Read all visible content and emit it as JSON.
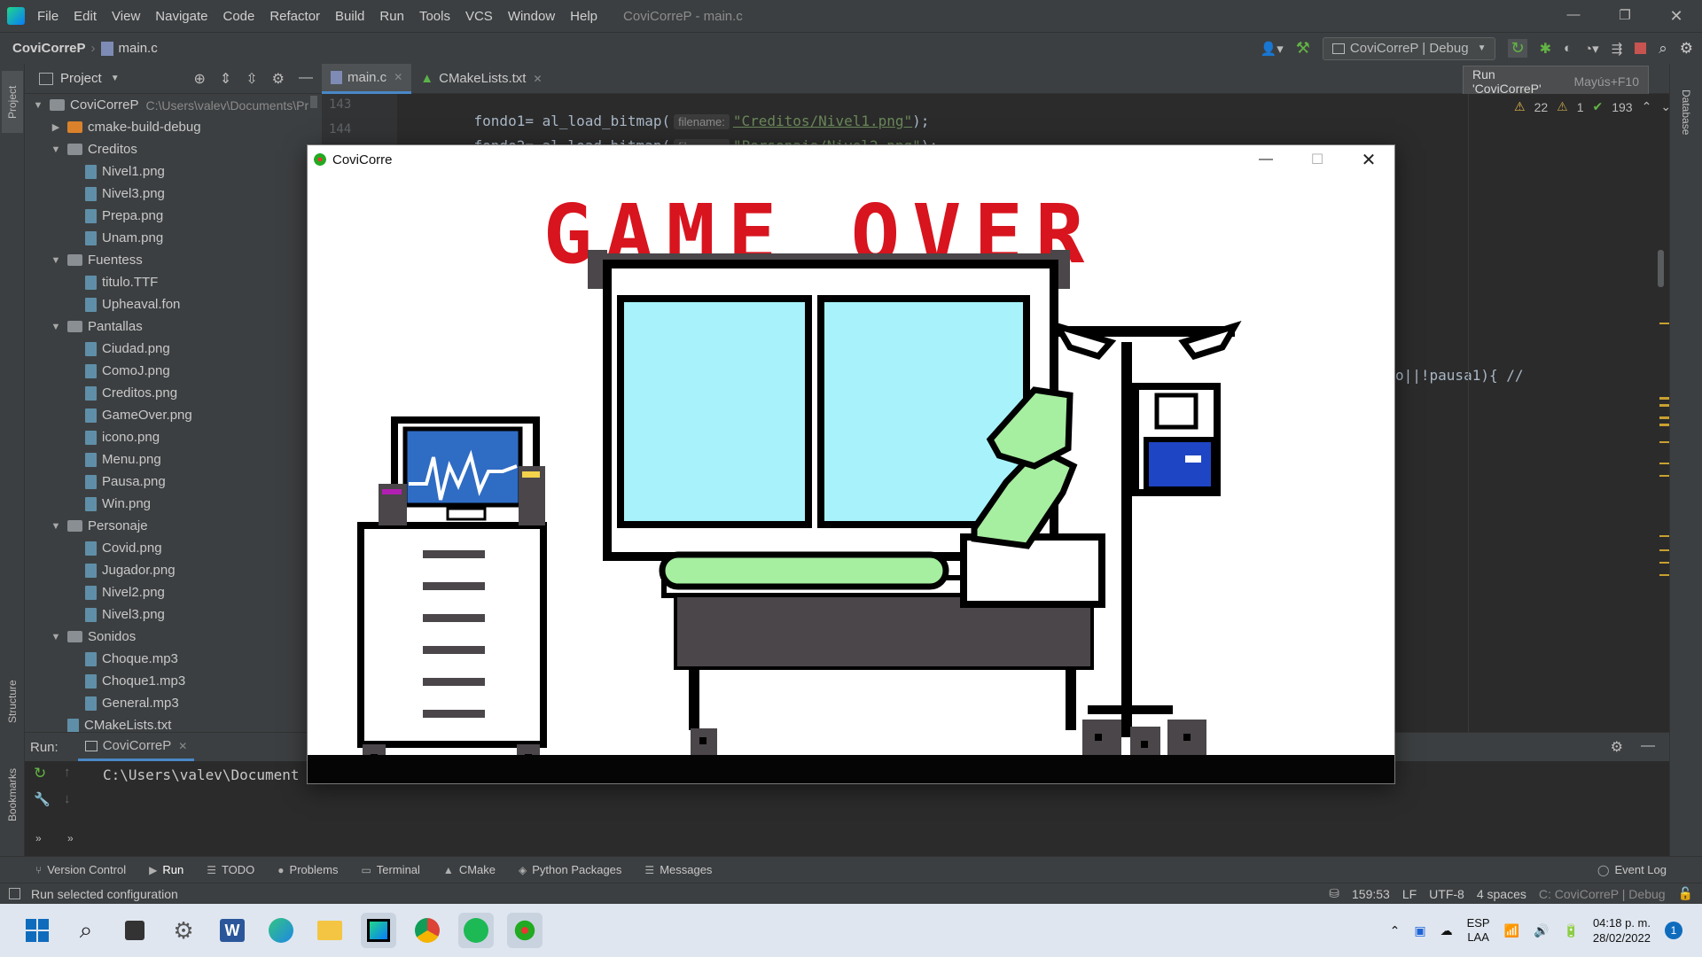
{
  "menubar": {
    "items": [
      "File",
      "Edit",
      "View",
      "Navigate",
      "Code",
      "Refactor",
      "Build",
      "Run",
      "Tools",
      "VCS",
      "Window",
      "Help"
    ],
    "title": "CoviCorreP - main.c"
  },
  "navbar": {
    "project": "CoviCorreP",
    "file": "main.c",
    "run_config": "CoviCorreP | Debug"
  },
  "tooltip": {
    "text": "Run 'CoviCorreP'",
    "shortcut": "Mayús+F10"
  },
  "project_panel": {
    "title": "Project",
    "root_name": "CoviCorreP",
    "root_path": "C:\\Users\\valev\\Documents\\Pr",
    "tree": [
      {
        "label": "cmake-build-debug",
        "kind": "folder-orange",
        "depth": 1,
        "arrow": "▶"
      },
      {
        "label": "Creditos",
        "kind": "folder",
        "depth": 1,
        "arrow": "▼"
      },
      {
        "label": "Nivel1.png",
        "kind": "file",
        "depth": 2,
        "arrow": ""
      },
      {
        "label": "Nivel3.png",
        "kind": "file",
        "depth": 2,
        "arrow": ""
      },
      {
        "label": "Prepa.png",
        "kind": "file",
        "depth": 2,
        "arrow": ""
      },
      {
        "label": "Unam.png",
        "kind": "file",
        "depth": 2,
        "arrow": ""
      },
      {
        "label": "Fuentess",
        "kind": "folder",
        "depth": 1,
        "arrow": "▼"
      },
      {
        "label": "titulo.TTF",
        "kind": "file",
        "depth": 2,
        "arrow": ""
      },
      {
        "label": "Upheaval.fon",
        "kind": "file",
        "depth": 2,
        "arrow": ""
      },
      {
        "label": "Pantallas",
        "kind": "folder",
        "depth": 1,
        "arrow": "▼"
      },
      {
        "label": "Ciudad.png",
        "kind": "file",
        "depth": 2,
        "arrow": ""
      },
      {
        "label": "ComoJ.png",
        "kind": "file",
        "depth": 2,
        "arrow": ""
      },
      {
        "label": "Creditos.png",
        "kind": "file",
        "depth": 2,
        "arrow": ""
      },
      {
        "label": "GameOver.png",
        "kind": "file",
        "depth": 2,
        "arrow": ""
      },
      {
        "label": "icono.png",
        "kind": "file",
        "depth": 2,
        "arrow": ""
      },
      {
        "label": "Menu.png",
        "kind": "file",
        "depth": 2,
        "arrow": ""
      },
      {
        "label": "Pausa.png",
        "kind": "file",
        "depth": 2,
        "arrow": ""
      },
      {
        "label": "Win.png",
        "kind": "file",
        "depth": 2,
        "arrow": ""
      },
      {
        "label": "Personaje",
        "kind": "folder",
        "depth": 1,
        "arrow": "▼"
      },
      {
        "label": "Covid.png",
        "kind": "file",
        "depth": 2,
        "arrow": ""
      },
      {
        "label": "Jugador.png",
        "kind": "file",
        "depth": 2,
        "arrow": ""
      },
      {
        "label": "Nivel2.png",
        "kind": "file",
        "depth": 2,
        "arrow": ""
      },
      {
        "label": "Nivel3.png",
        "kind": "file",
        "depth": 2,
        "arrow": ""
      },
      {
        "label": "Sonidos",
        "kind": "folder",
        "depth": 1,
        "arrow": "▼"
      },
      {
        "label": "Choque.mp3",
        "kind": "file",
        "depth": 2,
        "arrow": ""
      },
      {
        "label": "Choque1.mp3",
        "kind": "file",
        "depth": 2,
        "arrow": ""
      },
      {
        "label": "General.mp3",
        "kind": "file",
        "depth": 2,
        "arrow": ""
      },
      {
        "label": "CMakeLists.txt",
        "kind": "file",
        "depth": 1,
        "arrow": ""
      }
    ]
  },
  "editor": {
    "tabs": [
      "main.c",
      "CMakeLists.txt"
    ],
    "lines": [
      {
        "num": "143",
        "pre": "fondo1= al_load_bitmap(",
        "hint": "filename:",
        "str": "\"Creditos/Nivel1.png\"",
        "post": ");"
      },
      {
        "num": "144",
        "pre": "fondo2= al_load_bitmap(",
        "hint": "filename:",
        "str": "\"Personaje/Nivel2.png\"",
        "post": ");"
      }
    ],
    "partial_code": "o||!pausa1){ //",
    "inspections": {
      "warnings": "22",
      "weak_warnings": "1",
      "ok": "193"
    }
  },
  "left_strip": {
    "project": "Project",
    "structure": "Structure",
    "bookmarks": "Bookmarks"
  },
  "right_strip": {
    "database": "Database"
  },
  "run_panel": {
    "label": "Run:",
    "tab": "CoviCorreP",
    "output": "C:\\Users\\valev\\Document"
  },
  "tool_tabs": [
    {
      "icon": "⑂",
      "label": "Version Control"
    },
    {
      "icon": "▶",
      "label": "Run"
    },
    {
      "icon": "☰",
      "label": "TODO"
    },
    {
      "icon": "●",
      "label": "Problems"
    },
    {
      "icon": "▭",
      "label": "Terminal"
    },
    {
      "icon": "▲",
      "label": "CMake"
    },
    {
      "icon": "◈",
      "label": "Python Packages"
    },
    {
      "icon": "☰",
      "label": "Messages"
    }
  ],
  "event_log": "Event Log",
  "statusbar": {
    "message": "Run selected configuration",
    "position": "159:53",
    "line_sep": "LF",
    "encoding": "UTF-8",
    "indent": "4 spaces",
    "context": "C: CoviCorreP | Debug"
  },
  "game_window": {
    "title": "CoviCorre",
    "game_over_text": "GAME OVER"
  },
  "taskbar": {
    "lang": "ESP",
    "lang2": "LAA",
    "time": "04:18 p. m.",
    "date": "28/02/2022",
    "notifications": "1"
  },
  "colors": {
    "accent": "#4a88c7",
    "game_over_red": "#d8141e",
    "monitor_blue": "#2f6cc4",
    "glass": "#a8f3fb",
    "mattress": "#a6eea0",
    "frame_gray": "#4a4649"
  }
}
